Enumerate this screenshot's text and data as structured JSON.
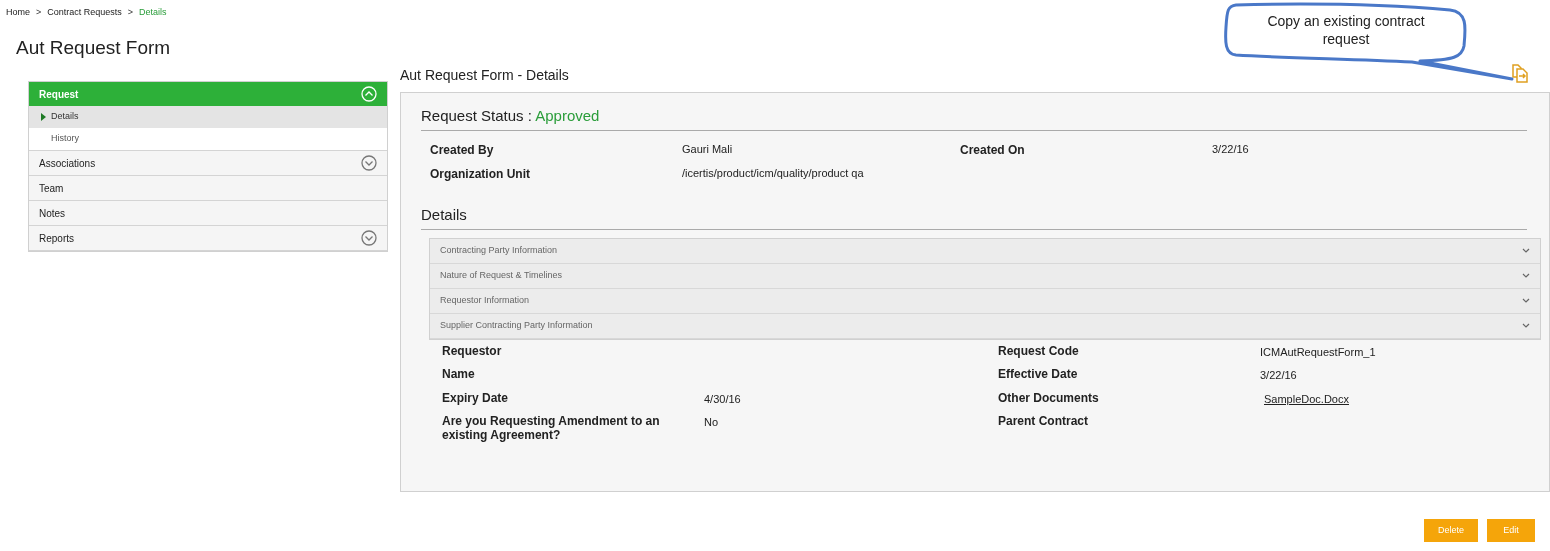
{
  "breadcrumb": [
    {
      "label": "Home",
      "current": false
    },
    {
      "label": "Contract Requests",
      "current": false,
      "separator": ">"
    },
    {
      "label": "Details",
      "current": true,
      "separator": ">"
    }
  ],
  "page_title": "Aut Request Form",
  "callout": {
    "text": "Copy an existing contract request"
  },
  "sidebar": [
    {
      "label": "Request",
      "selected": true,
      "expanded": true,
      "children": [
        {
          "label": "Details",
          "selected": true
        },
        {
          "label": "History",
          "selected": false
        }
      ]
    },
    {
      "label": "Associations",
      "selected": false,
      "expanded": false
    },
    {
      "label": "Team",
      "selected": false
    },
    {
      "label": "Notes",
      "selected": false
    },
    {
      "label": "Reports",
      "selected": false,
      "expanded": false
    }
  ],
  "section_title": "Aut Request Form - Details",
  "status": {
    "label": "Request Status :",
    "value": "Approved"
  },
  "summary": [
    {
      "label": "Created By",
      "value": "Gauri Mali",
      "label2": "Created On",
      "value2": "3/22/16"
    },
    {
      "label": "Organization Unit",
      "value": "/icertis/product/icm/quality/product qa"
    }
  ],
  "details_title": "Details",
  "panels": [
    {
      "label": "Contracting Party Information",
      "expanded": false
    },
    {
      "label": "Nature of Request & Timelines",
      "expanded": false
    },
    {
      "label": "Requestor Information",
      "expanded": false
    },
    {
      "label": "Supplier Contracting Party Information",
      "expanded": false
    }
  ],
  "fields": [
    {
      "left": {
        "label": "Requestor"
      },
      "right": {
        "label": "Request Code",
        "value": "ICMAutRequestForm_1",
        "kind": "text"
      }
    },
    {
      "left": {
        "label": "Name"
      },
      "right": {
        "label": "Effective Date",
        "value": "3/22/16",
        "kind": "text"
      }
    },
    {
      "left": {
        "label": "Expiry Date",
        "value": "4/30/16"
      },
      "right": {
        "label": "Other Documents",
        "value": "SampleDoc.Docx",
        "kind": "link"
      }
    },
    {
      "left": {
        "label": "Are you Requesting Amendment to an existing Agreement?",
        "value": "No"
      },
      "right": {
        "label": "Parent Contract",
        "kind": "text"
      }
    }
  ],
  "buttons": [
    "Delete",
    "Edit"
  ]
}
